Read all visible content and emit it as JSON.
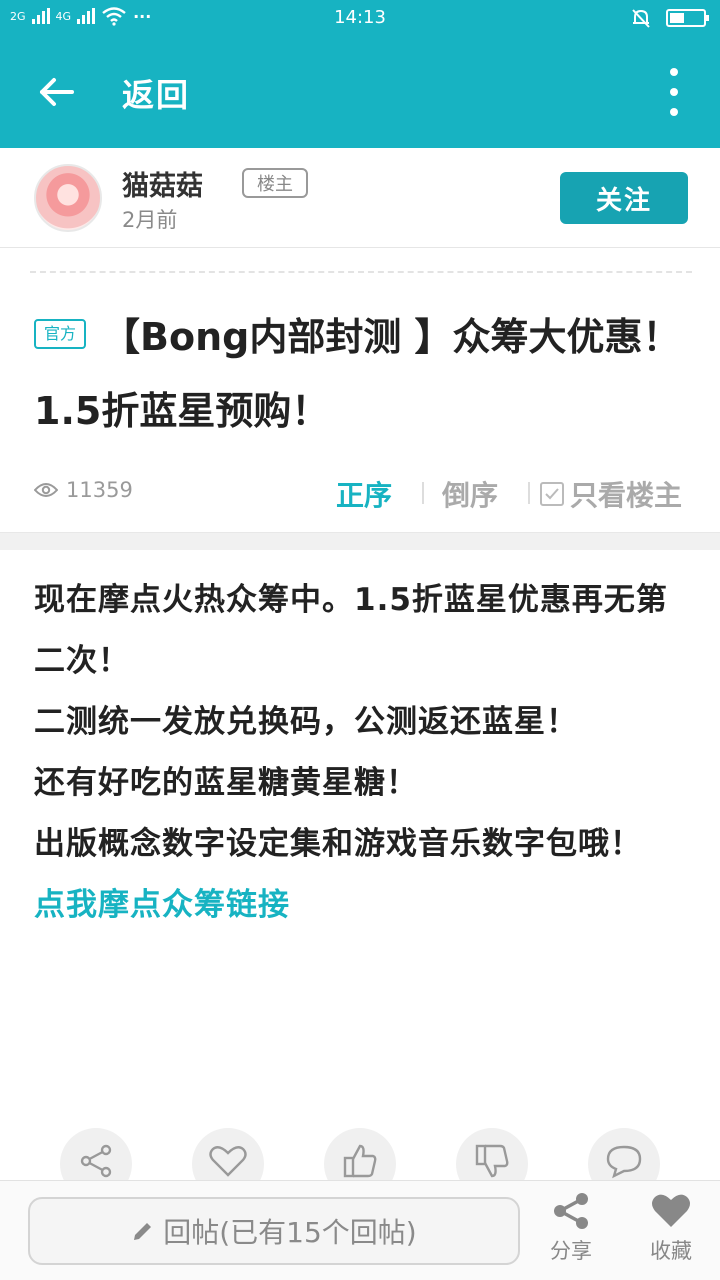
{
  "status_bar": {
    "network_1": "2G",
    "network_2": "4G",
    "more": "···",
    "time": "14:13"
  },
  "app_bar": {
    "back_label": "返回"
  },
  "author": {
    "name": "猫菇菇",
    "badge": "楼主",
    "time": "2月前",
    "follow_label": "关注"
  },
  "post": {
    "tag": "官方",
    "title": "【Bong内部封测 】众筹大优惠！1.5折蓝星预购！",
    "views": "11359",
    "sort_asc": "正序",
    "sort_desc": "倒序",
    "only_owner": "只看楼主",
    "body": [
      "现在摩点火热众筹中。1.5折蓝星优惠再无第二次！",
      "二测统一发放兑换码，公测返还蓝星！",
      "还有好吃的蓝星糖黄星糖！",
      "出版概念数字设定集和游戏音乐数字包哦！"
    ],
    "link_text": "点我摩点众筹链接"
  },
  "bottom_bar": {
    "reply_placeholder": "回帖(已有15个回帖)",
    "share_label": "分享",
    "favorite_label": "收藏"
  },
  "colors": {
    "accent": "#17b3c2",
    "follow_button": "#17a3b2"
  }
}
